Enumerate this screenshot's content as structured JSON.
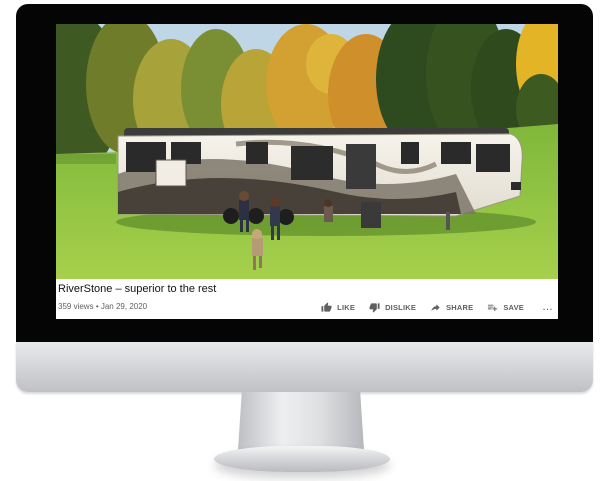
{
  "video": {
    "title": "RiverStone – superior to the rest",
    "views": "359 views",
    "separator": "•",
    "date": "Jan 29, 2020",
    "camper_brand_text": "RiverStone"
  },
  "actions": [
    {
      "label": "LIKE",
      "icon": "thumbs-up-icon"
    },
    {
      "label": "DISLIKE",
      "icon": "thumbs-down-icon"
    },
    {
      "label": "SHARE",
      "icon": "share-arrow-icon"
    },
    {
      "label": "SAVE",
      "icon": "playlist-add-icon"
    }
  ],
  "more_label": "…",
  "colors": {
    "bezel": "#050505",
    "grass": "#8ec63f",
    "text_primary": "#111111",
    "text_secondary": "#606060"
  }
}
